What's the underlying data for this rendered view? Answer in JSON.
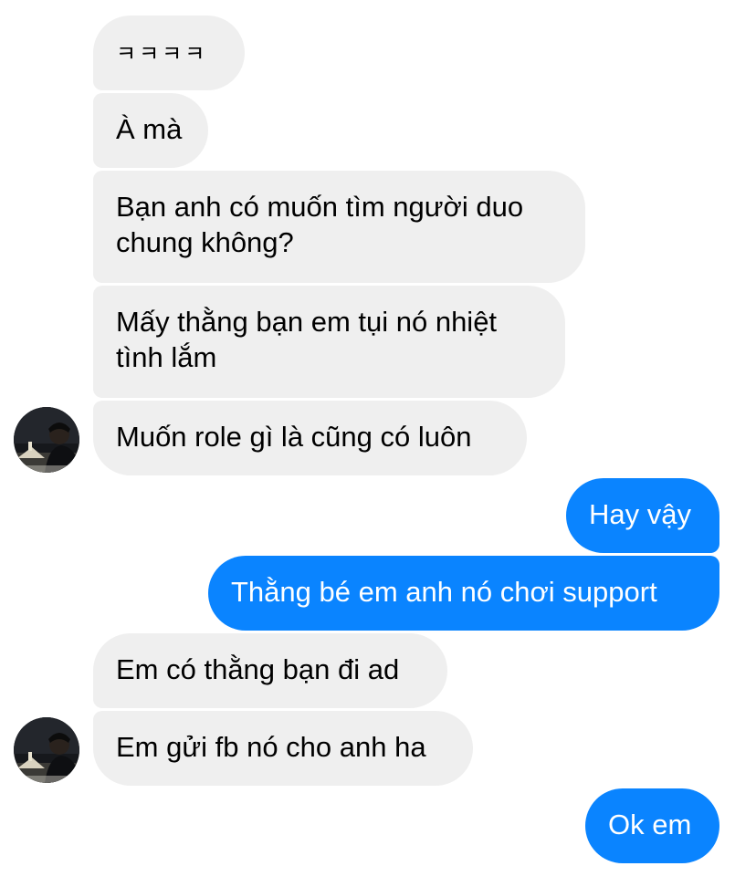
{
  "conversation": {
    "messages": [
      {
        "side": "in",
        "text": "ㅋㅋㅋㅋ"
      },
      {
        "side": "in",
        "text": "À mà"
      },
      {
        "side": "in",
        "lines": [
          "Bạn anh có muốn tìm người duo",
          "chung không?"
        ]
      },
      {
        "side": "in",
        "lines": [
          "Mấy thằng bạn em tụi nó nhiệt",
          "tình lắm"
        ]
      },
      {
        "side": "in",
        "text": "Muốn role gì là cũng có luôn"
      },
      {
        "side": "out",
        "text": "Hay vậy"
      },
      {
        "side": "out",
        "text": "Thằng bé em anh nó chơi support"
      },
      {
        "side": "in",
        "text": "Em có thằng bạn đi ad"
      },
      {
        "side": "in",
        "text": "Em gửi fb nó cho anh ha"
      },
      {
        "side": "out",
        "text": "Ok em"
      }
    ]
  },
  "colors": {
    "incoming_bubble": "#efefef",
    "outgoing_bubble": "#0a84ff",
    "outgoing_text": "#ffffff"
  },
  "icons": {
    "contact_avatar": "contact-avatar-photo"
  }
}
